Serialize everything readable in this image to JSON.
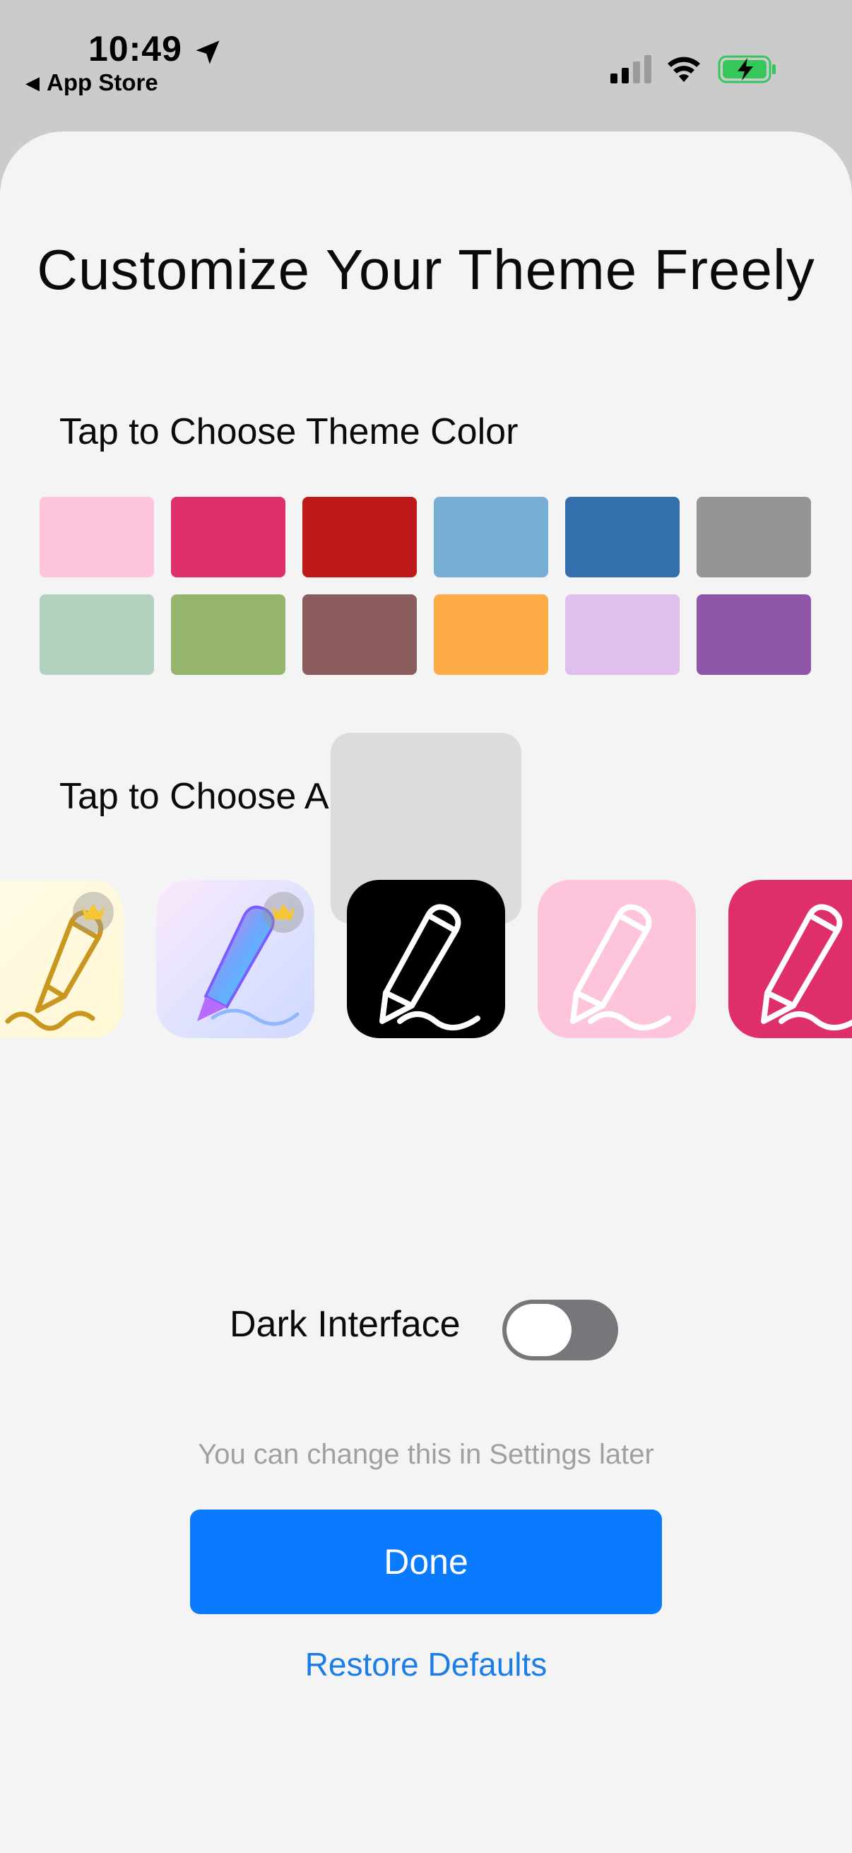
{
  "status_bar": {
    "time": "10:49",
    "back_app": "App Store",
    "icons": [
      "location-arrow-icon",
      "cellular-signal-icon",
      "wifi-icon",
      "battery-charging-icon"
    ],
    "battery_color": "#34c759"
  },
  "title": "Customize Your Theme Freely",
  "theme_color": {
    "label": "Tap to Choose Theme Color",
    "swatches": [
      "#fdc4dc",
      "#de2f6c",
      "#be1a1a",
      "#76aed3",
      "#346fad",
      "#959595",
      "#b2d1be",
      "#96b56d",
      "#8a5c5b",
      "#fdac48",
      "#e0bfec",
      "#8f55a7"
    ]
  },
  "app_icon": {
    "label": "Tap to Choose App Icon",
    "icons": [
      {
        "name": "gold-pencil-icon",
        "premium": true,
        "selected": false
      },
      {
        "name": "holographic-pencil-icon",
        "premium": true,
        "selected": false
      },
      {
        "name": "black-pencil-icon",
        "premium": false,
        "selected": true
      },
      {
        "name": "pink-pencil-icon",
        "premium": false,
        "selected": false
      },
      {
        "name": "magenta-pencil-icon",
        "premium": false,
        "selected": false
      }
    ]
  },
  "dark_interface": {
    "label": "Dark Interface",
    "enabled": false
  },
  "hint": "You can change this in Settings later",
  "done_label": "Done",
  "restore_label": "Restore Defaults",
  "accent_color": "#0a7aff"
}
